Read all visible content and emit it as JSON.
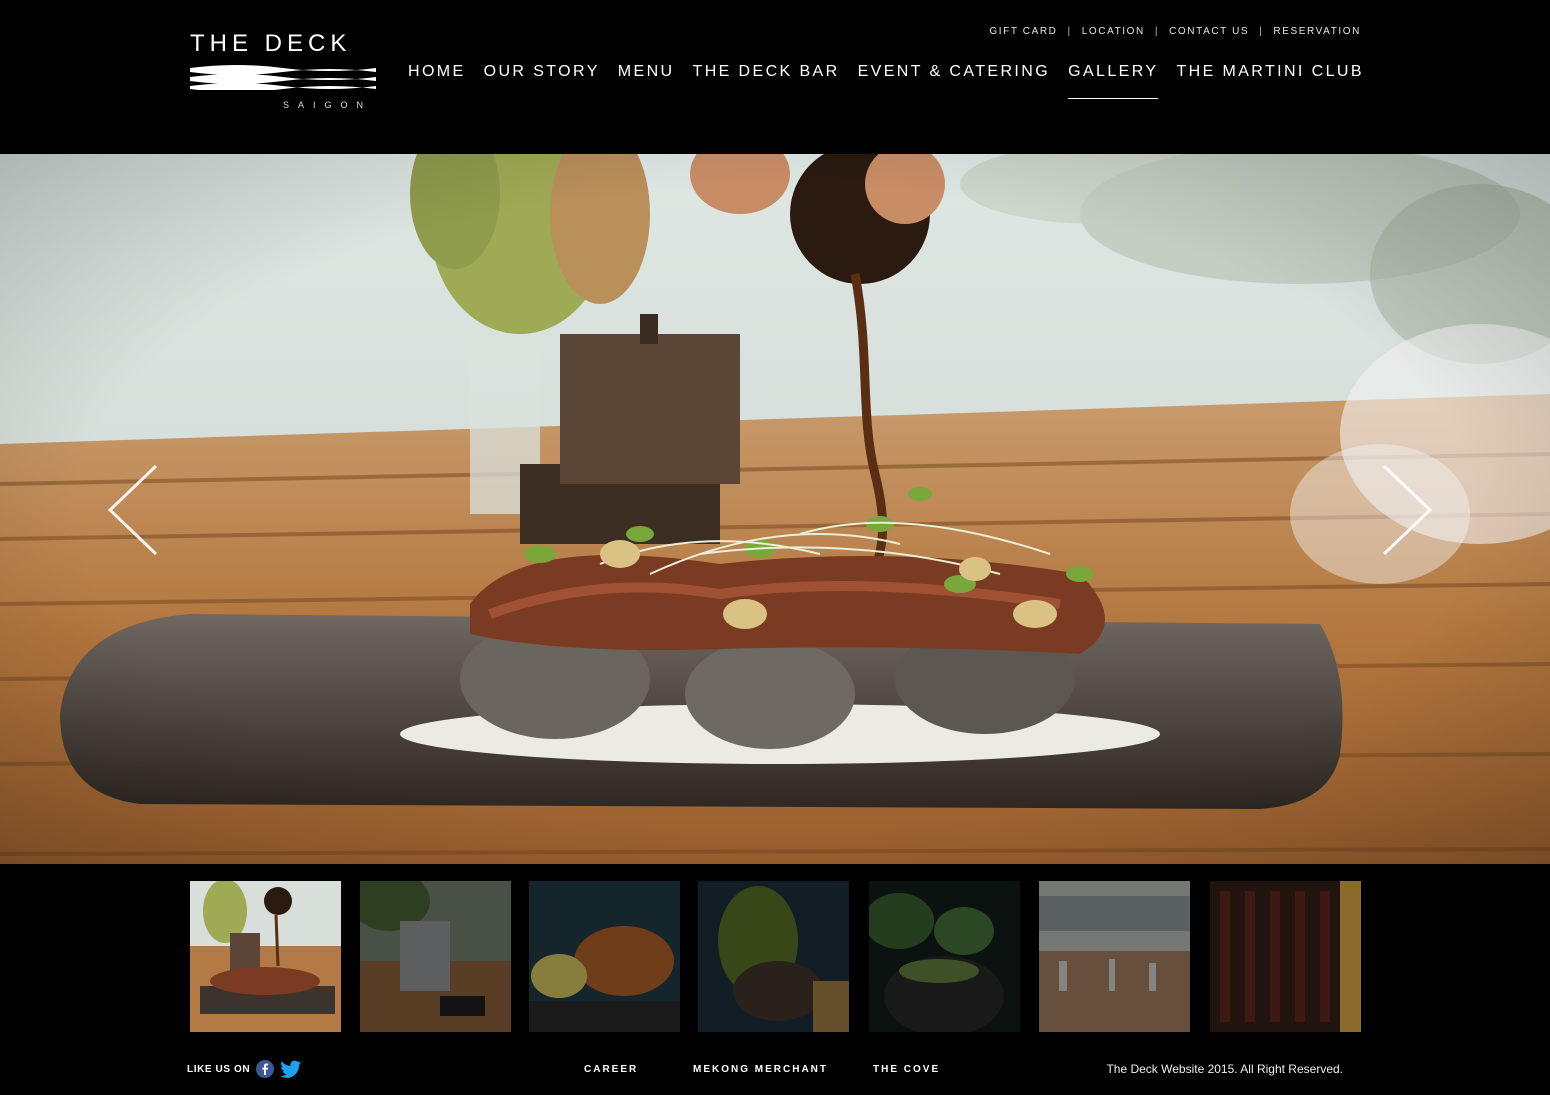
{
  "brand": {
    "name": "THE DECK",
    "location": "SAIGON"
  },
  "utility_nav": [
    "GIFT CARD",
    "LOCATION",
    "CONTACT US",
    "RESERVATION"
  ],
  "utility_separator": "|",
  "main_nav": [
    {
      "label": "HOME",
      "active": false
    },
    {
      "label": "OUR STORY",
      "active": false
    },
    {
      "label": "MENU",
      "active": false
    },
    {
      "label": "THE DECK BAR",
      "active": false
    },
    {
      "label": "EVENT & CATERING",
      "active": false
    },
    {
      "label": "GALLERY",
      "active": true
    },
    {
      "label": "THE MARTINI CLUB",
      "active": false
    }
  ],
  "gallery": {
    "prev_icon": "chevron-left-icon",
    "next_icon": "chevron-right-icon",
    "selected_index": 0,
    "thumbnail_count": 7
  },
  "footer": {
    "like_text": "LIKE US ON",
    "social": [
      "facebook-icon",
      "twitter-icon"
    ],
    "links": [
      "CAREER",
      "MEKONG MERCHANT",
      "THE COVE"
    ],
    "copyright": "The Deck Website 2015. All Right Reserved."
  },
  "colors": {
    "background": "#000000",
    "text": "#ffffff",
    "facebook": "#3b5998",
    "twitter": "#1da1f2",
    "wood": "#b47a45"
  }
}
